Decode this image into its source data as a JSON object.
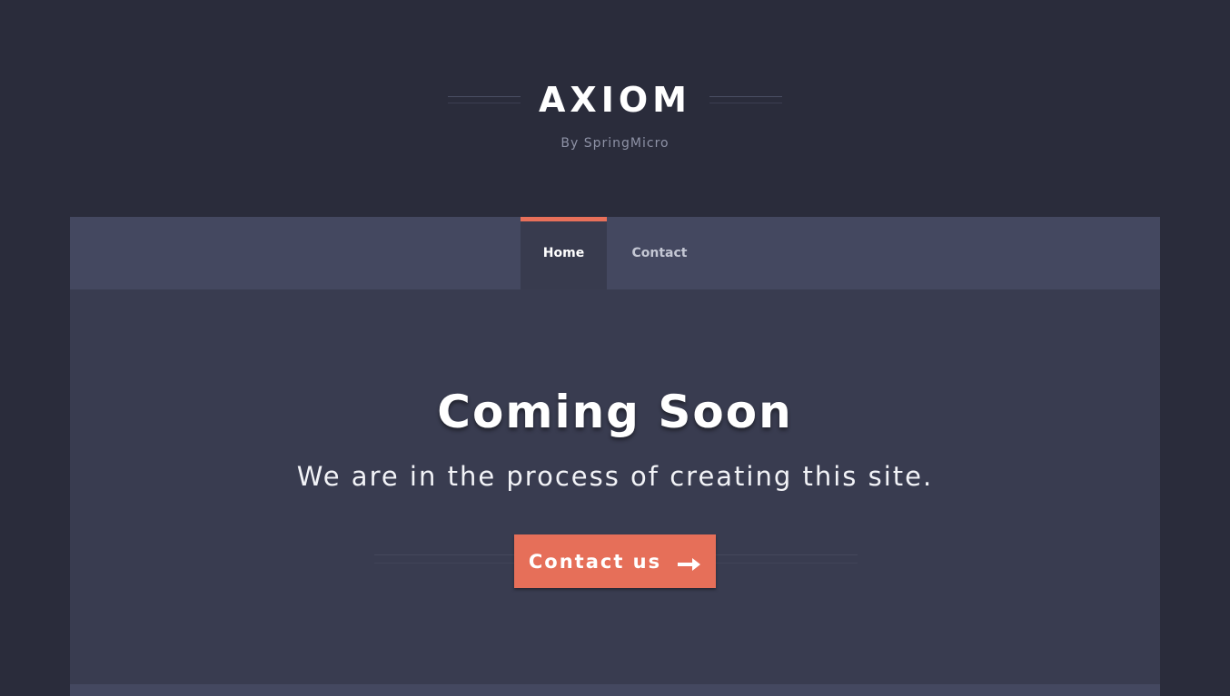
{
  "brand": {
    "title": "AXIOM",
    "byline": "By SpringMicro"
  },
  "nav": {
    "items": [
      {
        "label": "Home",
        "active": true
      },
      {
        "label": "Contact",
        "active": false
      }
    ]
  },
  "hero": {
    "headline": "Coming Soon",
    "tagline": "We are in the process of creating this site.",
    "cta_label": "Contact us",
    "cta_icon": "arrow-right-icon"
  },
  "colors": {
    "background": "#2a2c3b",
    "nav_bar": "#444860",
    "panel": "#393c50",
    "accent": "#e66f59"
  }
}
